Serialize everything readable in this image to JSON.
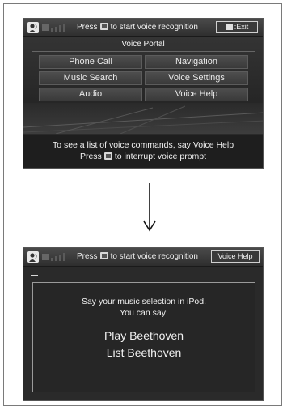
{
  "top_screen": {
    "status_bar": {
      "prompt_before": "Press",
      "prompt_after": "to start voice recognition",
      "exit_label": ":Exit"
    },
    "title": "Voice Portal",
    "menu": [
      {
        "label": "Phone Call"
      },
      {
        "label": "Navigation"
      },
      {
        "label": "Music Search"
      },
      {
        "label": "Voice Settings"
      },
      {
        "label": "Audio"
      },
      {
        "label": "Voice Help"
      }
    ],
    "hint": {
      "line1": "To see a list of voice commands, say Voice Help",
      "line2_before": "Press",
      "line2_after": "to interrupt voice prompt"
    }
  },
  "transition": {
    "icon": "down-arrow-icon"
  },
  "bottom_screen": {
    "status_bar": {
      "prompt_before": "Press",
      "prompt_after": "to start voice recognition",
      "voice_help_label": "Voice Help"
    },
    "message": {
      "line1": "Say your music selection in iPod.",
      "line2": "You can say:",
      "commands": [
        "Play Beethoven",
        "List Beethoven"
      ]
    }
  },
  "icons": {
    "voice_badge": "voice-recognition-icon",
    "signal": "signal-strength-icon",
    "talk": "talk-button-icon",
    "exit": "back-icon"
  }
}
